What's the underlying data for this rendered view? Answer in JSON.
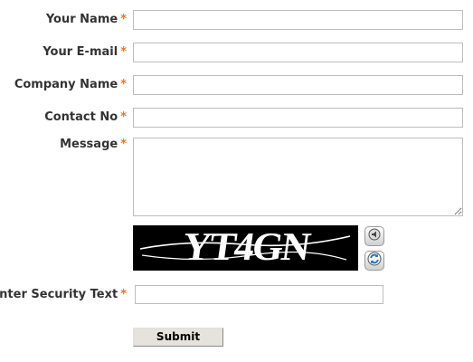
{
  "form": {
    "fields": [
      {
        "label": "Your Name",
        "value": ""
      },
      {
        "label": "Your E-mail",
        "value": ""
      },
      {
        "label": "Company Name",
        "value": ""
      },
      {
        "label": "Contact No",
        "value": ""
      },
      {
        "label": "Message",
        "value": ""
      }
    ],
    "required_marker": "*",
    "captcha": {
      "text": "YT4GN",
      "audio_icon": "speaker-icon",
      "refresh_icon": "refresh-icon"
    },
    "security": {
      "label": "Enter Security Text",
      "value": ""
    },
    "submit_label": "Submit"
  },
  "colors": {
    "label_text": "#333333",
    "required_marker": "#e87722",
    "field_border": "#bdbdbd",
    "captcha_bg": "#000000",
    "captcha_text": "#ffffff",
    "submit_bg": "#e6e3dd"
  }
}
